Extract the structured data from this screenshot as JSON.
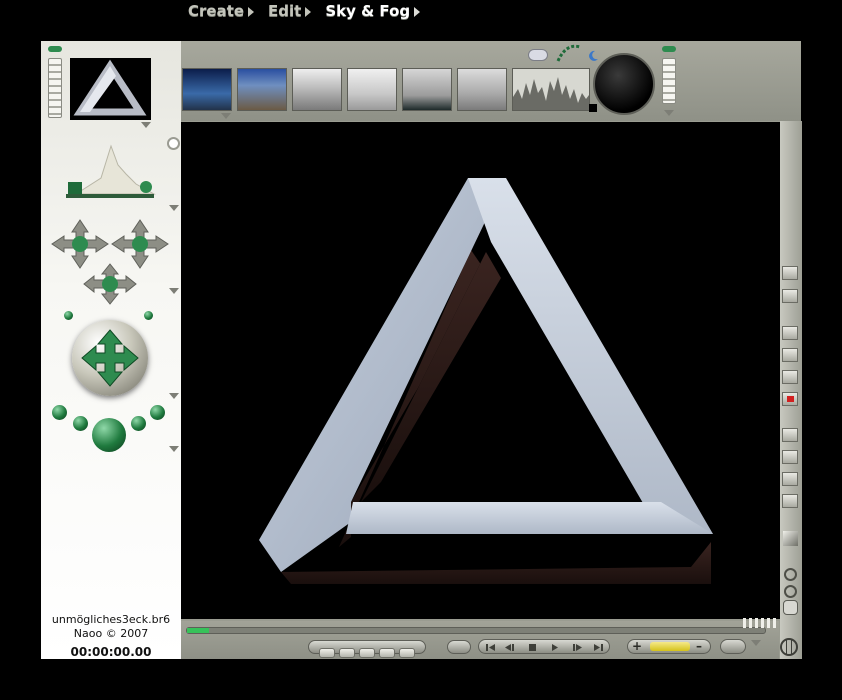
{
  "menu": {
    "create": "Create",
    "edit": "Edit",
    "sky_fog": "Sky & Fog"
  },
  "file": {
    "name": "unmögliches3eck.br6",
    "author": "Naoo © 2007",
    "timecode": "00:00:00.00"
  },
  "thumbnails": [
    {
      "name": "sky-preset-1",
      "colors": [
        "#0b1d4a",
        "#3a6aa8",
        "#8fa8c0"
      ]
    },
    {
      "name": "sky-preset-2",
      "colors": [
        "#2a4fa0",
        "#6f8fc0",
        "#c9a277"
      ]
    },
    {
      "name": "sky-preset-3",
      "colors": [
        "#d9d9d9",
        "#bdbdbd",
        "#7a7a7a"
      ]
    },
    {
      "name": "sky-preset-4",
      "colors": [
        "#e3e3e3",
        "#c8c8c8",
        "#8c8c8c"
      ]
    },
    {
      "name": "sky-preset-5",
      "colors": [
        "#b8b8b8",
        "#7f7f7f",
        "#2a2a2a"
      ]
    },
    {
      "name": "sky-preset-6",
      "colors": [
        "#c8c8c8",
        "#9c9c9c",
        "#6a6a6a"
      ]
    }
  ],
  "icons": {
    "cloud": "cloud-icon",
    "sun_path": "sun-path-icon",
    "moon": "moon-icon",
    "sun_dial": "sun-dial-icon",
    "pencil": "pencil-icon",
    "eraser": "eraser-icon",
    "zoom_in": "zoom-in-icon",
    "zoom_out": "zoom-out-icon",
    "hand": "hand-icon",
    "globe": "globe-icon",
    "cube": "cube-icon"
  },
  "colors": {
    "frame": "#9a9c91",
    "sidebar": "#f4f4ef",
    "viewport": "#000000",
    "accent_green": "#2e8b4f",
    "timeline_green": "#37c25a",
    "key_yellow": "#d4c21a"
  },
  "playback": {
    "controls": [
      "first-frame",
      "step-back",
      "stop",
      "play",
      "step-forward",
      "last-frame"
    ]
  }
}
